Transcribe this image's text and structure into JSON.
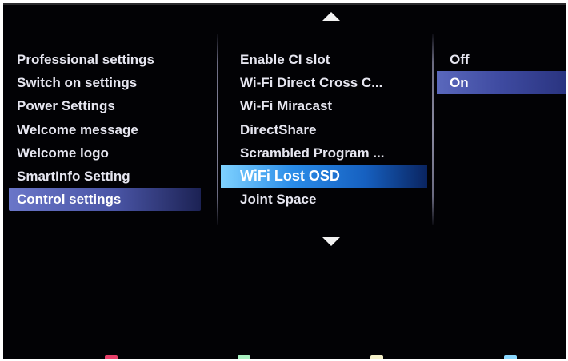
{
  "left_menu": {
    "items": [
      {
        "label": "Professional settings",
        "selected": false
      },
      {
        "label": "Switch on settings",
        "selected": false
      },
      {
        "label": "Power Settings",
        "selected": false
      },
      {
        "label": "Welcome message",
        "selected": false
      },
      {
        "label": "Welcome logo",
        "selected": false
      },
      {
        "label": "SmartInfo Setting",
        "selected": false
      },
      {
        "label": "Control settings",
        "selected": true
      }
    ]
  },
  "middle_menu": {
    "items": [
      {
        "label": "Enable CI slot",
        "selected": false
      },
      {
        "label": "Wi-Fi Direct Cross C...",
        "selected": false
      },
      {
        "label": "Wi-Fi Miracast",
        "selected": false
      },
      {
        "label": "DirectShare",
        "selected": false
      },
      {
        "label": "Scrambled Program ...",
        "selected": false
      },
      {
        "label": "WiFi Lost OSD",
        "selected": true
      },
      {
        "label": "Joint Space",
        "selected": false
      }
    ]
  },
  "right_menu": {
    "items": [
      {
        "label": "Off",
        "selected": false
      },
      {
        "label": "On",
        "selected": true
      }
    ]
  },
  "icons": {
    "scroll_up": "triangle-up-icon",
    "scroll_down": "triangle-down-icon"
  },
  "color_keys": {
    "red": "#e8406a",
    "green": "#a8f0c0",
    "yellow": "#f4f0c8",
    "blue": "#8ad8ff"
  },
  "colors": {
    "background": "#020205",
    "text": "#e6e6f0",
    "highlight_active": "#2a8ce8",
    "highlight_path": "#4a55a6"
  }
}
